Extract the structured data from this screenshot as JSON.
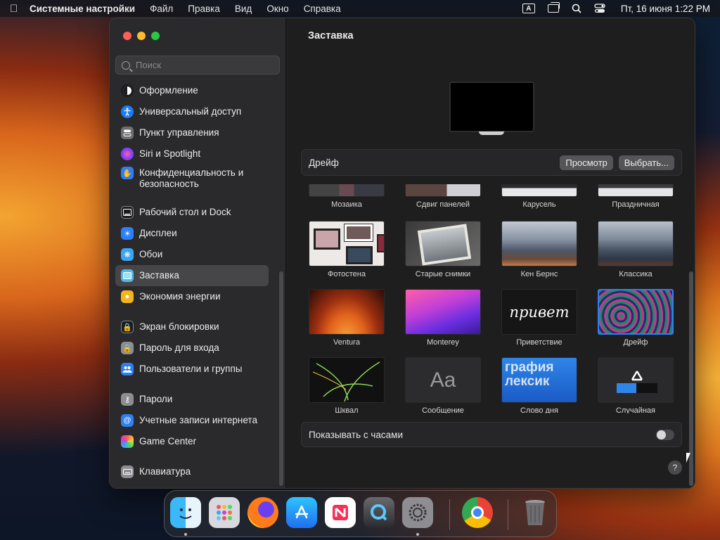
{
  "menubar": {
    "app_name": "Системные настройки",
    "menus": [
      "Файл",
      "Правка",
      "Вид",
      "Окно",
      "Справка"
    ],
    "input_indicator": "A",
    "datetime": "Пт, 16 июня  1:22 PM"
  },
  "sidebar": {
    "search_placeholder": "Поиск",
    "items": [
      {
        "label": "Оформление",
        "icon": "appearance-icon",
        "color": "#1c1c1e"
      },
      {
        "label": "Универсальный доступ",
        "icon": "accessibility-icon",
        "color": "#1e7cf2"
      },
      {
        "label": "Пункт управления",
        "icon": "control-center-icon",
        "color": "#6e6e72"
      },
      {
        "label": "Siri и Spotlight",
        "icon": "siri-icon",
        "color": "#c543d6"
      },
      {
        "label": "Конфиденциальность и безопасность",
        "icon": "privacy-hand-icon",
        "color": "#2f7cf6"
      },
      {
        "label": "Рабочий стол и Dock",
        "icon": "desktop-dock-icon",
        "color": "#1c1c1e"
      },
      {
        "label": "Дисплеи",
        "icon": "displays-icon",
        "color": "#2d7ff6"
      },
      {
        "label": "Обои",
        "icon": "wallpaper-icon",
        "color": "#3aa6f0"
      },
      {
        "label": "Заставка",
        "icon": "screensaver-icon",
        "color": "#4fb8e8"
      },
      {
        "label": "Экономия энергии",
        "icon": "energy-icon",
        "color": "#f2b51c"
      },
      {
        "label": "Экран блокировки",
        "icon": "lock-screen-icon",
        "color": "#1c1c1e"
      },
      {
        "label": "Пароль для входа",
        "icon": "login-password-icon",
        "color": "#8e8e92"
      },
      {
        "label": "Пользователи и группы",
        "icon": "users-groups-icon",
        "color": "#2d7ff6"
      },
      {
        "label": "Пароли",
        "icon": "passwords-key-icon",
        "color": "#8e8e92"
      },
      {
        "label": "Учетные записи интернета",
        "icon": "internet-accounts-icon",
        "color": "#2d7ff6"
      },
      {
        "label": "Game Center",
        "icon": "game-center-icon",
        "color": "#e9e9ea"
      },
      {
        "label": "Клавиатура",
        "icon": "keyboard-icon",
        "color": "#8e8e92"
      }
    ],
    "active_index": 8
  },
  "main": {
    "title": "Заставка",
    "current_saver": "Дрейф",
    "preview_button": "Просмотр",
    "choose_button": "Выбрать...",
    "savers_top_row": [
      "Мозаика",
      "Сдвиг панелей",
      "Карусель",
      "Праздничная"
    ],
    "savers": [
      {
        "label": "Фотостена",
        "kind": "photowall"
      },
      {
        "label": "Старые снимки",
        "kind": "vintage"
      },
      {
        "label": "Кен Бернс",
        "kind": "mountains"
      },
      {
        "label": "Классика",
        "kind": "mountains2"
      },
      {
        "label": "Ventura",
        "kind": "ventura"
      },
      {
        "label": "Monterey",
        "kind": "monterey"
      },
      {
        "label": "Приветствие",
        "kind": "hello",
        "text": "привет"
      },
      {
        "label": "Дрейф",
        "kind": "drift",
        "selected": true
      },
      {
        "label": "Шквал",
        "kind": "flurry"
      },
      {
        "label": "Сообщение",
        "kind": "message",
        "text": "Aa"
      },
      {
        "label": "Слово дня",
        "kind": "word",
        "text": "графия лексик"
      },
      {
        "label": "Случайная",
        "kind": "random"
      }
    ],
    "show_clock_label": "Показывать с часами",
    "show_clock": false,
    "help_label": "?"
  },
  "dock": {
    "apps": [
      "finder-icon",
      "launchpad-icon",
      "firefox-icon",
      "app-store-icon",
      "news-icon",
      "quicktime-icon",
      "system-settings-icon",
      "chrome-icon",
      "trash-icon"
    ]
  }
}
